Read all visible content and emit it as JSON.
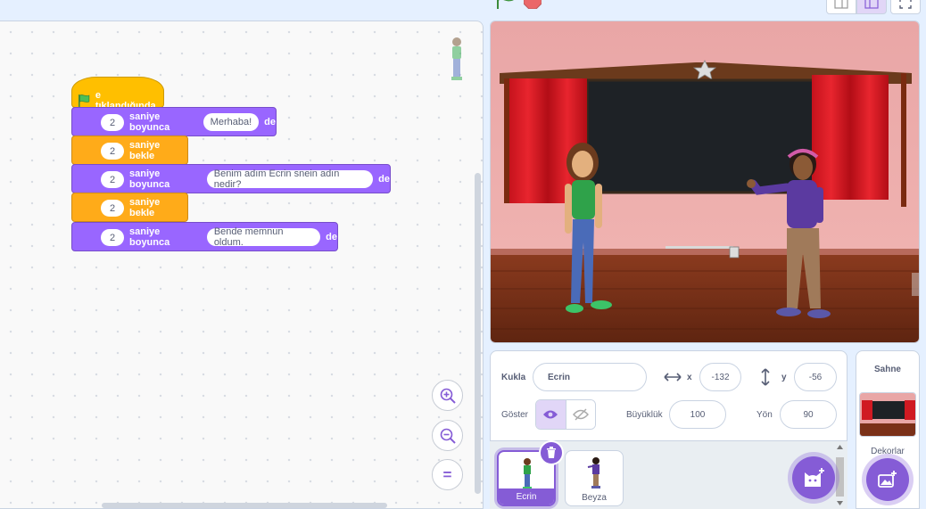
{
  "script": {
    "hat_label": "e tıklandığında",
    "blocks": [
      {
        "kind": "looks",
        "num": "2",
        "label": "saniye boyunca",
        "text": "Merhaba!",
        "tail": "de"
      },
      {
        "kind": "control",
        "num": "2",
        "label": "saniye bekle"
      },
      {
        "kind": "looks",
        "num": "2",
        "label": "saniye boyunca",
        "text": "Benim adım Ecrin snein adın nedir?",
        "tail": "de"
      },
      {
        "kind": "control",
        "num": "2",
        "label": "saniye bekle"
      },
      {
        "kind": "looks",
        "num": "2",
        "label": "saniye boyunca",
        "text": "Bende memnun oldum.",
        "tail": "de"
      }
    ]
  },
  "zoom": {
    "zoom_in": "zoom-in-icon",
    "zoom_out": "zoom-out-icon",
    "reset": "="
  },
  "sprite_info": {
    "sprite_label": "Kukla",
    "sprite_name": "Ecrin",
    "x_label": "x",
    "x_value": "-132",
    "y_label": "y",
    "y_value": "-56",
    "show_label": "Göster",
    "size_label": "Büyüklük",
    "size_value": "100",
    "direction_label": "Yön",
    "direction_value": "90"
  },
  "sprites": [
    {
      "name": "Ecrin",
      "selected": true
    },
    {
      "name": "Beyza",
      "selected": false
    }
  ],
  "stage_panel": {
    "title": "Sahne",
    "backdrops_label": "Dekorlar"
  },
  "colors": {
    "looks": "#9966ff",
    "control": "#ffab19",
    "events": "#ffbf00",
    "accent": "#855cd6"
  }
}
